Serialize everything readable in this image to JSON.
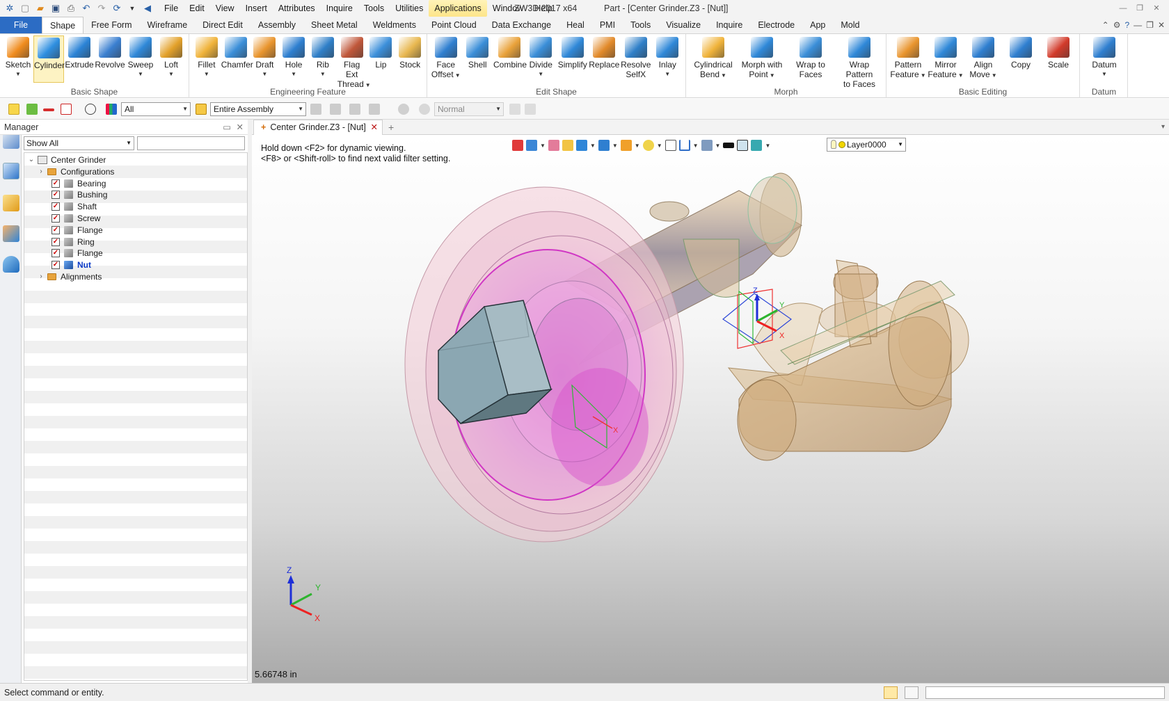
{
  "titlebar": {
    "menus": [
      "File",
      "Edit",
      "View",
      "Insert",
      "Attributes",
      "Inquire",
      "Tools",
      "Utilities",
      "Applications",
      "Window",
      "Help"
    ],
    "highlighted_menu": "Applications",
    "app_title": "ZW3D 2017  x64",
    "doc_title": "Part - [Center Grinder.Z3 - [Nut]]"
  },
  "ribbon_tabs": {
    "file": "File",
    "tabs": [
      "Shape",
      "Free Form",
      "Wireframe",
      "Direct Edit",
      "Assembly",
      "Sheet Metal",
      "Weldments",
      "Point Cloud",
      "Data Exchange",
      "Heal",
      "PMI",
      "Tools",
      "Visualize",
      "Inquire",
      "Electrode",
      "App",
      "Mold"
    ],
    "active": "Shape"
  },
  "ribbon": {
    "groups": [
      {
        "label": "Basic Shape",
        "buttons": [
          {
            "l1": "Sketch",
            "l2": "",
            "dd": true,
            "color": "#f08c1e"
          },
          {
            "l1": "Cylinder",
            "l2": "",
            "dd": false,
            "color": "#2f8fe0",
            "active": true
          },
          {
            "l1": "Extrude",
            "l2": "",
            "dd": false,
            "color": "#2b83d6"
          },
          {
            "l1": "Revolve",
            "l2": "",
            "dd": false,
            "color": "#3a7fd0"
          },
          {
            "l1": "Sweep",
            "l2": "",
            "dd": true,
            "color": "#2f88d8"
          },
          {
            "l1": "Loft",
            "l2": "",
            "dd": true,
            "color": "#e3a12a"
          }
        ]
      },
      {
        "label": "Engineering Feature",
        "buttons": [
          {
            "l1": "Fillet",
            "l2": "",
            "dd": true,
            "color": "#f0b33a"
          },
          {
            "l1": "Chamfer",
            "l2": "",
            "dd": false,
            "color": "#3a8ed8"
          },
          {
            "l1": "Draft",
            "l2": "",
            "dd": true,
            "color": "#e9952e"
          },
          {
            "l1": "Hole",
            "l2": "",
            "dd": true,
            "color": "#2e7fd0"
          },
          {
            "l1": "Rib",
            "l2": "",
            "dd": true,
            "color": "#2f7fc8"
          },
          {
            "l1": "Flag Ext",
            "l2": "Thread",
            "dd": true,
            "color": "#c0573a"
          },
          {
            "l1": "Lip",
            "l2": "",
            "dd": false,
            "color": "#3c8fda"
          },
          {
            "l1": "Stock",
            "l2": "",
            "dd": false,
            "color": "#e8b850"
          }
        ]
      },
      {
        "label": "Edit Shape",
        "buttons": [
          {
            "l1": "Face",
            "l2": "Offset",
            "dd": true,
            "color": "#2f7fd0"
          },
          {
            "l1": "Shell",
            "l2": "",
            "dd": false,
            "color": "#3a8ed8"
          },
          {
            "l1": "Combine",
            "l2": "",
            "dd": false,
            "color": "#e9a23a"
          },
          {
            "l1": "Divide",
            "l2": "",
            "dd": true,
            "color": "#3a8ed8"
          },
          {
            "l1": "Simplify",
            "l2": "",
            "dd": false,
            "color": "#2f88d8"
          },
          {
            "l1": "Replace",
            "l2": "",
            "dd": false,
            "color": "#e28a2a"
          },
          {
            "l1": "Resolve",
            "l2": "SelfX",
            "dd": false,
            "color": "#2f7fc8"
          },
          {
            "l1": "Inlay",
            "l2": "",
            "dd": true,
            "color": "#2f88d8"
          }
        ]
      },
      {
        "label": "Morph",
        "buttons": [
          {
            "l1": "Cylindrical",
            "l2": "Bend",
            "dd": true,
            "color": "#f0b33a"
          },
          {
            "l1": "Morph with",
            "l2": "Point",
            "dd": true,
            "color": "#2f88d8"
          },
          {
            "l1": "Wrap to",
            "l2": "Faces",
            "dd": false,
            "color": "#3a8ed8"
          },
          {
            "l1": "Wrap Pattern",
            "l2": "to Faces",
            "dd": false,
            "color": "#2f88d8"
          }
        ]
      },
      {
        "label": "Basic Editing",
        "buttons": [
          {
            "l1": "Pattern",
            "l2": "Feature",
            "dd": true,
            "color": "#e9952e"
          },
          {
            "l1": "Mirror",
            "l2": "Feature",
            "dd": true,
            "color": "#2f88d8"
          },
          {
            "l1": "Align",
            "l2": "Move",
            "dd": true,
            "color": "#2f7fd0"
          },
          {
            "l1": "Copy",
            "l2": "",
            "dd": false,
            "color": "#2f7fd0"
          },
          {
            "l1": "Scale",
            "l2": "",
            "dd": false,
            "color": "#d23b2b"
          }
        ]
      },
      {
        "label": "Datum",
        "buttons": [
          {
            "l1": "Datum",
            "l2": "",
            "dd": true,
            "color": "#2f7fd0"
          }
        ]
      }
    ]
  },
  "toolbar2": {
    "filter": "All",
    "scope": "Entire Assembly",
    "mode": "Normal"
  },
  "manager": {
    "title": "Manager",
    "show": "Show All",
    "tree": [
      {
        "label": "Center Grinder",
        "level": 0,
        "expand": "v",
        "icon": "assembly",
        "check": false
      },
      {
        "label": "Configurations",
        "level": 1,
        "expand": ">",
        "icon": "folder",
        "check": false
      },
      {
        "label": "Bearing",
        "level": 2,
        "expand": "",
        "icon": "part",
        "check": true
      },
      {
        "label": "Bushing",
        "level": 2,
        "expand": "",
        "icon": "part",
        "check": true
      },
      {
        "label": "Shaft",
        "level": 2,
        "expand": "",
        "icon": "part",
        "check": true
      },
      {
        "label": "Screw",
        "level": 2,
        "expand": "",
        "icon": "part",
        "check": true
      },
      {
        "label": "Flange",
        "level": 2,
        "expand": "",
        "icon": "part",
        "check": true
      },
      {
        "label": "Ring",
        "level": 2,
        "expand": "",
        "icon": "part",
        "check": true
      },
      {
        "label": "Flange",
        "level": 2,
        "expand": "",
        "icon": "part",
        "check": true
      },
      {
        "label": "Nut",
        "level": 2,
        "expand": "",
        "icon": "part-active",
        "check": true,
        "selected": true
      },
      {
        "label": "Alignments",
        "level": 1,
        "expand": ">",
        "icon": "folder",
        "check": false
      }
    ]
  },
  "document": {
    "tab": "Center Grinder.Z3 - [Nut]",
    "layer": "Layer0000",
    "hint1": "Hold down <F2> for dynamic viewing.",
    "hint2": "<F8> or <Shift-roll> to find next valid filter setting.",
    "scale": "5.66748 in",
    "axis_labels": {
      "x": "X",
      "y": "Y",
      "z": "Z"
    }
  },
  "status": {
    "message": "Select command or entity."
  }
}
